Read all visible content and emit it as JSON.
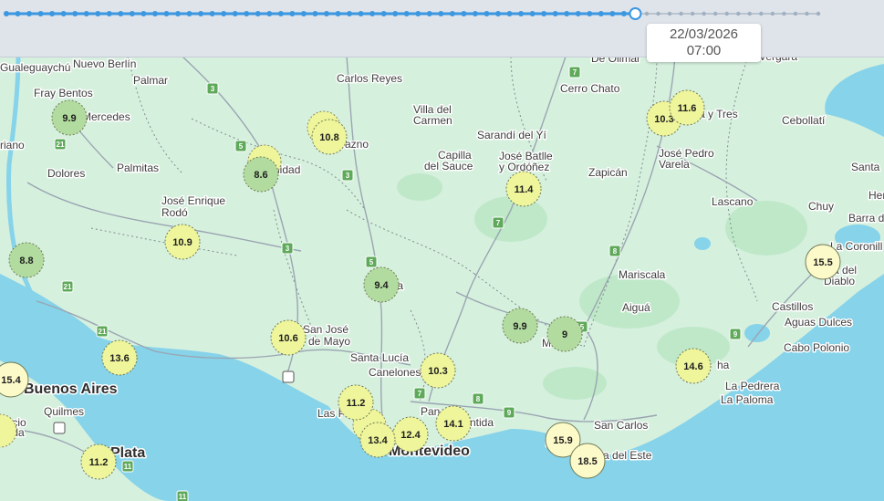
{
  "timeline": {
    "date": "22/03/2026",
    "time": "07:00",
    "total_steps": 72,
    "current_step": 55
  },
  "colors": {
    "water": "#86d3ea",
    "land": "#d6f0de",
    "park": "#b8e6c4",
    "road": "#9aa5b1",
    "route_badge": "#5fa95a",
    "track_active": "#3b97e0",
    "track_inactive": "#b9c4cf",
    "marker_yellow": "#eef59a",
    "marker_light": "#fdfac9",
    "marker_green": "#b2dc9f"
  },
  "places": [
    {
      "name": "Gualeguaychú"
    },
    {
      "name": "Nuevo Berlín"
    },
    {
      "name": "Palmar"
    },
    {
      "name": "Carlos Reyes"
    },
    {
      "name": "De Olimar"
    },
    {
      "name": "Vergara"
    },
    {
      "name": "Fray Bentos"
    },
    {
      "name": "Mercedes"
    },
    {
      "name": "Cerro Chato"
    },
    {
      "name": "Villa del"
    },
    {
      "name": "Carmen"
    },
    {
      "name": "nta y Tres"
    },
    {
      "name": "Cebollatí"
    },
    {
      "name": "riano"
    },
    {
      "name": "Sarandí del Yí"
    },
    {
      "name": "razno"
    },
    {
      "name": "nidad"
    },
    {
      "name": "Dolores"
    },
    {
      "name": "Palmitas"
    },
    {
      "name": "Capilla"
    },
    {
      "name": "del Sauce"
    },
    {
      "name": "José Batlle"
    },
    {
      "name": "y Ordóñez"
    },
    {
      "name": "Zapicán"
    },
    {
      "name": "José Pedro"
    },
    {
      "name": "Varela"
    },
    {
      "name": "Santa"
    },
    {
      "name": "Her"
    },
    {
      "name": "José Enrique"
    },
    {
      "name": "Rodó"
    },
    {
      "name": "Lascano"
    },
    {
      "name": "Chuy"
    },
    {
      "name": "Barra d"
    },
    {
      "name": "La Coronill"
    },
    {
      "name": "nta del"
    },
    {
      "name": "Diablo"
    },
    {
      "name": "Mariscala"
    },
    {
      "name": "ida"
    },
    {
      "name": "Aiguá"
    },
    {
      "name": "Castillos"
    },
    {
      "name": "Aguas Dulces"
    },
    {
      "name": "San José"
    },
    {
      "name": "de Mayo"
    },
    {
      "name": "Santa Lucía"
    },
    {
      "name": "Canelones"
    },
    {
      "name": "Cabo Polonio"
    },
    {
      "name": "M"
    },
    {
      "name": "La Pedrera"
    },
    {
      "name": "La Paloma"
    },
    {
      "name": "ha"
    },
    {
      "name": "Buenos Aires",
      "big": true
    },
    {
      "name": "Quilmes"
    },
    {
      "name": "encio"
    },
    {
      "name": "arela"
    },
    {
      "name": "Las P"
    },
    {
      "name": "Pan"
    },
    {
      "name": "ntida"
    },
    {
      "name": "San Carlos"
    },
    {
      "name": "Montevideo",
      "big": true
    },
    {
      "name": "Plata",
      "big": true
    },
    {
      "name": "P"
    },
    {
      "name": "nta del Este"
    }
  ],
  "routes": [
    "7",
    "3",
    "5",
    "3",
    "21",
    "5",
    "7",
    "8",
    "3",
    "21",
    "21",
    "9",
    "5",
    "1",
    "7",
    "8",
    "9",
    "1",
    "11",
    "11"
  ],
  "markers": [
    {
      "value": "9.9",
      "tone": "green"
    },
    {
      "value": "10.8",
      "tone": "yellow"
    },
    {
      "value": "8.6",
      "tone": "green"
    },
    {
      "value": "10.3",
      "tone": "yellow"
    },
    {
      "value": "11.6",
      "tone": "yellow"
    },
    {
      "value": "11.4",
      "tone": "yellow"
    },
    {
      "value": "10.9",
      "tone": "yellow"
    },
    {
      "value": "8.8",
      "tone": "green"
    },
    {
      "value": "15.5",
      "tone": "light"
    },
    {
      "value": "9.4",
      "tone": "green"
    },
    {
      "value": "9.9",
      "tone": "green"
    },
    {
      "value": "9",
      "tone": "green"
    },
    {
      "value": "10.6",
      "tone": "yellow"
    },
    {
      "value": "13.6",
      "tone": "yellow"
    },
    {
      "value": "15.4",
      "tone": "light"
    },
    {
      "value": "10.3",
      "tone": "yellow"
    },
    {
      "value": "14.6",
      "tone": "yellow"
    },
    {
      "value": "11.2",
      "tone": "yellow"
    },
    {
      "value": "14.1",
      "tone": "yellow"
    },
    {
      "value": "12.4",
      "tone": "yellow"
    },
    {
      "value": "13.4",
      "tone": "yellow"
    },
    {
      "value": "15.9",
      "tone": "light"
    },
    {
      "value": "18.5",
      "tone": "light"
    },
    {
      "value": "11.2",
      "tone": "yellow"
    }
  ]
}
